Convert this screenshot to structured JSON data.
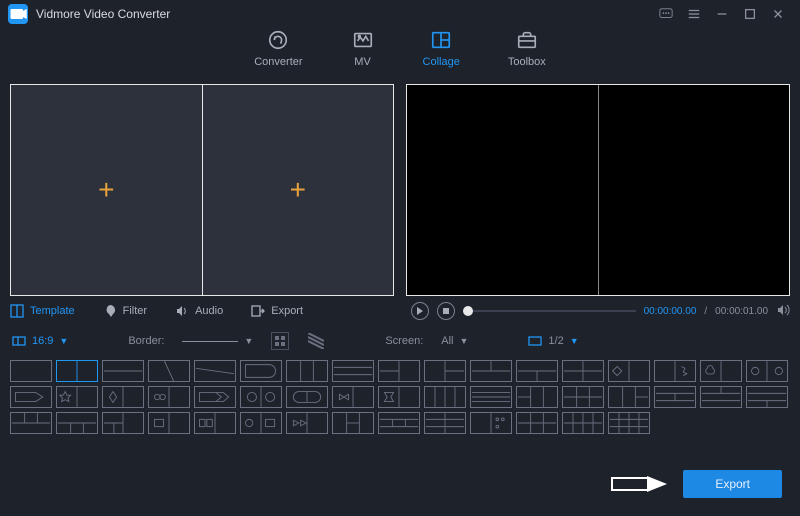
{
  "app": {
    "title": "Vidmore Video Converter"
  },
  "main_tabs": {
    "converter": "Converter",
    "mv": "MV",
    "collage": "Collage",
    "toolbox": "Toolbox"
  },
  "sub_tabs": {
    "template": "Template",
    "filter": "Filter",
    "audio": "Audio",
    "export": "Export"
  },
  "playback": {
    "current": "00:00:00.00",
    "duration": "00:00:01.00"
  },
  "options": {
    "aspect": "16:9",
    "border_label": "Border:",
    "screen_label": "Screen:",
    "screen_value": "All",
    "page": "1/2"
  },
  "buttons": {
    "export": "Export"
  }
}
